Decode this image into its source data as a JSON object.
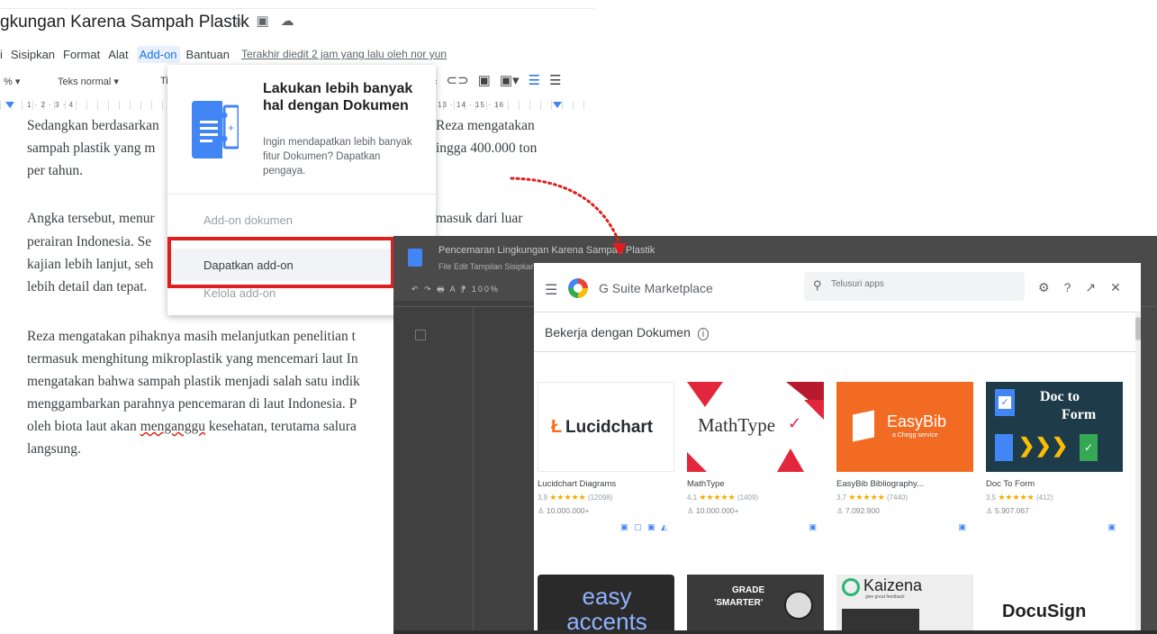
{
  "doc": {
    "title": "gkungan Karena Sampah Plastik",
    "menu": [
      "Sisipkan",
      "Format",
      "Alat",
      "Add-on",
      "Bantuan"
    ],
    "menu_prefix": "i",
    "last_edit": "Terakhir diedit 2 jam yang lalu oleh nor yun",
    "toolbar": {
      "zoom": "% ▾",
      "style": "Teks normal ▾",
      "font": "Ti"
    },
    "ruler_left": "1 · 2 · 3 · 4",
    "ruler_right": "13 · 14 · 15 · 16",
    "paragraph1": [
      "Sedangkan berdasarkan",
      "sampah plastik yang m",
      "per tahun."
    ],
    "paragraph1_right": [
      "Reza mengatakan",
      "ingga 400.000 ton"
    ],
    "paragraph2": [
      "Angka tersebut, menur",
      "perairan Indonesia. Se",
      "kajian lebih lanjut, seh",
      "lebih detail dan tepat."
    ],
    "paragraph2_right": [
      "masuk dari luar"
    ],
    "paragraph3": [
      "Reza mengatakan pihaknya masih melanjutkan penelitian t",
      "termasuk menghitung mikroplastik yang mencemari laut In",
      "mengatakan bahwa sampah plastik menjadi salah satu indik",
      "menggambarkan parahnya pencemaran di laut Indonesia. P",
      "oleh biota laut akan ",
      "menganggu",
      " kesehatan, terutama salura",
      "langsung."
    ]
  },
  "addon_menu": {
    "promo_title": "Lakukan lebih banyak hal dengan Dokumen",
    "promo_desc": "Ingin mendapatkan lebih banyak fitur Dokumen? Dapatkan pengaya.",
    "section_label": "Add-on dokumen",
    "get_addons": "Dapatkan add-on",
    "manage_addons": "Kelola add-on"
  },
  "overlay": {
    "doc_title": "Pencemaran Lingkungan Karena Sampah Plastik",
    "doc_menu": "File  Edit  Tampilan  Sisipkan  Format  Alat  Add-on  Bantuan",
    "tools": "↶ ↷ 🖶 A ⁋  100%"
  },
  "marketplace": {
    "name": "G Suite Marketplace",
    "search_placeholder": "Telusuri apps",
    "heading": "Bekerja dengan Dokumen",
    "cards": [
      {
        "name": "Lucidchart Diagrams",
        "rating": "3,9",
        "stars": "★★★★★",
        "reviews": "(12098)",
        "users": "10.000.000+",
        "logo_text": "Lucidchart",
        "apps": "▣ ▢ ▣ ◭"
      },
      {
        "name": "MathType",
        "rating": "4,1",
        "stars": "★★★★★",
        "reviews": "(1409)",
        "users": "10.000.000+",
        "logo_text": "MathType",
        "apps": "▣"
      },
      {
        "name": "EasyBib Bibliography...",
        "rating": "3,7",
        "stars": "★★★★★",
        "reviews": "(7440)",
        "users": "7.092.900",
        "logo_text": "EasyBib",
        "logo_sub": "a Chegg service",
        "apps": "▣"
      },
      {
        "name": "Doc To Form",
        "rating": "3,5",
        "stars": "★★★★★",
        "reviews": "(412)",
        "users": "5.907.067",
        "logo_text_1": "Doc to",
        "logo_text_2": "Form",
        "apps": "▣"
      }
    ],
    "cards_row2": [
      {
        "logo_text": "easy accents"
      },
      {
        "logo_text_1": "GRADE",
        "logo_text_2": "'SMARTER'"
      },
      {
        "logo_text": "Kaizena",
        "logo_sub": "give great feedback"
      },
      {
        "logo_text": "DocuSign"
      }
    ]
  }
}
